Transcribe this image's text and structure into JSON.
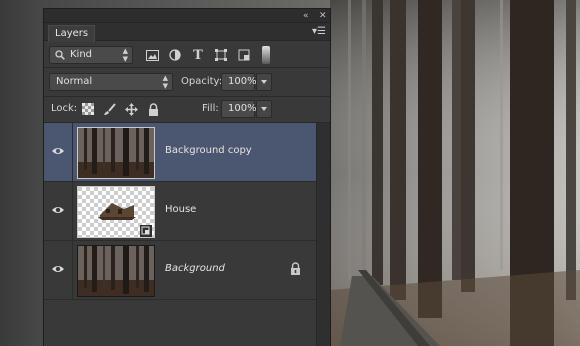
{
  "panel": {
    "tab_label": "Layers",
    "topbar_controls": "«  ✕",
    "tab_menu_icon": "panel-menu-icon",
    "filter": {
      "value": "Kind"
    },
    "blend_mode": {
      "value": "Normal"
    },
    "opacity": {
      "label": "Opacity:",
      "value": "100%"
    },
    "lock": {
      "label": "Lock:"
    },
    "fill": {
      "label": "Fill:",
      "value": "100%"
    }
  },
  "layers": [
    {
      "name": "Background copy",
      "selected": true,
      "visible": true,
      "italic": false,
      "locked": false,
      "thumb": "forest"
    },
    {
      "name": "House",
      "selected": false,
      "visible": true,
      "italic": false,
      "locked": false,
      "thumb": "house-transparent"
    },
    {
      "name": "Background",
      "selected": false,
      "visible": true,
      "italic": true,
      "locked": true,
      "thumb": "forest"
    }
  ],
  "colors": {
    "panel_bg": "#393939",
    "selected_layer": "#4b5670",
    "field_bg": "#4a4a4a"
  }
}
